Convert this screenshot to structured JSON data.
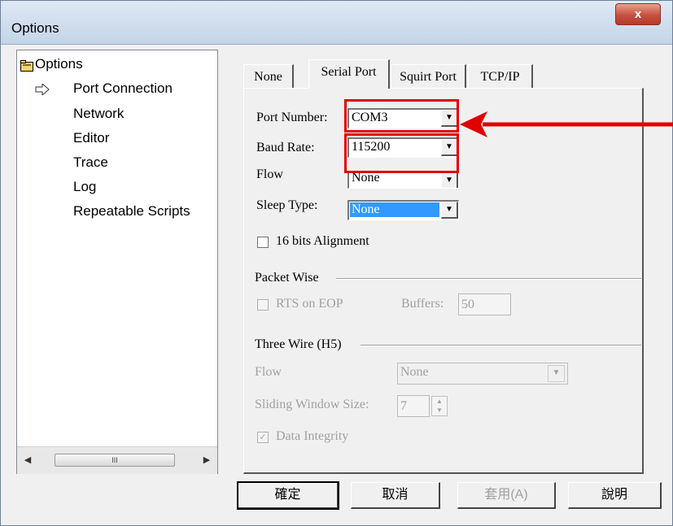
{
  "window": {
    "title": "Options",
    "close_label": "x"
  },
  "tree": {
    "root": "Options",
    "items": [
      {
        "label": "Port Connection",
        "selected": true
      },
      {
        "label": "Network"
      },
      {
        "label": "Editor"
      },
      {
        "label": "Trace"
      },
      {
        "label": "Log"
      },
      {
        "label": "Repeatable Scripts"
      }
    ],
    "scroll_thumb": "III"
  },
  "tabs": [
    {
      "label": "None"
    },
    {
      "label": "Serial Port",
      "active": true
    },
    {
      "label": "Squirt Port"
    },
    {
      "label": "TCP/IP"
    }
  ],
  "serial": {
    "port_number_label": "Port Number:",
    "port_number_value": "COM3",
    "baud_rate_label": "Baud Rate:",
    "baud_rate_value": "115200",
    "flow_label": "Flow",
    "flow_value": "None",
    "sleep_type_label": "Sleep Type:",
    "sleep_type_value": "None",
    "alignment_label": "16 bits Alignment"
  },
  "packet_wise": {
    "group_label": "Packet Wise",
    "rts_label": "RTS on EOP",
    "buffers_label": "Buffers:",
    "buffers_value": "50"
  },
  "three_wire": {
    "group_label": "Three Wire (H5)",
    "flow_label": "Flow",
    "flow_value": "None",
    "window_label": "Sliding Window Size:",
    "window_value": "7",
    "integrity_label": "Data Integrity"
  },
  "buttons": {
    "ok": "確定",
    "cancel": "取消",
    "apply": "套用(A)",
    "help": "說明"
  },
  "colors": {
    "annotation": "#e00000",
    "selection": "#3399ff"
  }
}
